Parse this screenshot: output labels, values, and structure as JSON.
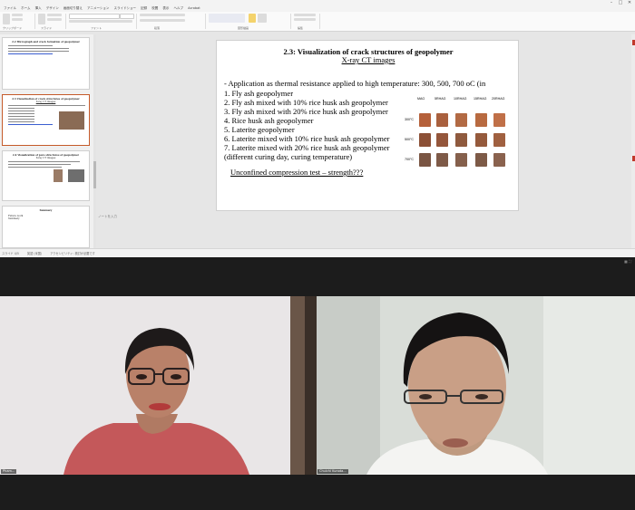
{
  "ribbon": {
    "tabs": [
      "ファイル",
      "ホーム",
      "挿入",
      "デザイン",
      "画面切り替え",
      "アニメーション",
      "スライドショー",
      "記録",
      "校閲",
      "表示",
      "ヘルプ",
      "Acrobat"
    ],
    "groups": [
      "クリップボード",
      "スライド",
      "フォント",
      "段落",
      "図形描画",
      "編集"
    ]
  },
  "thumbnails": [
    {
      "title": "2.2 Micrograph and crack formation of geopolymer",
      "line1": "Micrographs of fly ash geopolymer etc.",
      "link": "..."
    },
    {
      "title": "2.3 Visualization of crack structures of geopolymer",
      "subtitle": "X-ray CT images",
      "active": true
    },
    {
      "title": "2.4 Visualization of pore structures of geopolymer",
      "subtitle": "X-ray CT images"
    },
    {
      "title": "Summary",
      "line1": "Future work",
      "line2": "Summary"
    }
  ],
  "slide": {
    "title": "2.3: Visualization of crack structures of geopolymer",
    "subtitle": "X-ray CT images",
    "intro": "-   Application as thermal resistance applied to high temperature: 300, 500, 700 oC (in",
    "items": [
      "1.  Fly ash geopolymer",
      "2.  Fly ash mixed with 10% rice husk ash geopolymer",
      "3.  Fly ash mixed with 20% rice husk ash geopolymer",
      "4.  Rice husk ash geopolymer",
      "5.  Laterite geopolymer",
      "6.  Laterite mixed with 10% rice husk ash geopolymer",
      "7.  Laterite mixed with 20% rice husk ash geopolymer"
    ],
    "note": "(different curing day, curing temperature)",
    "link": "Unconfined compression test – strength???",
    "grid": {
      "columns": [
        "MAG",
        "5RHAG",
        "10RHAG",
        "15RHAG",
        "20RHAG"
      ],
      "rows": [
        "300°C",
        "500°C",
        "700°C"
      ],
      "colors": [
        [
          "#b5603a",
          "#a9603e",
          "#b26a44",
          "#b86a40",
          "#c07048"
        ],
        [
          "#8c5036",
          "#94563b",
          "#8f5a3e",
          "#955a3c",
          "#a06040"
        ],
        [
          "#7a5543",
          "#7e5a48",
          "#85604c",
          "#7d5a47",
          "#8a624e"
        ]
      ]
    }
  },
  "notes_placeholder": "ノートを入力",
  "statusbar": {
    "left": "スライド 4/5",
    "lang": "英語 (米国)",
    "accessibility": "アクセシビリティ: 検討が必要です"
  },
  "call": {
    "left_name": "Pham...",
    "right_name": "Chuichi Kuroda..."
  },
  "colors": {
    "active_thumb_border": "#c55a2a",
    "ribbon_bg": "#fafafa",
    "call_bg": "#1c1c1c"
  }
}
